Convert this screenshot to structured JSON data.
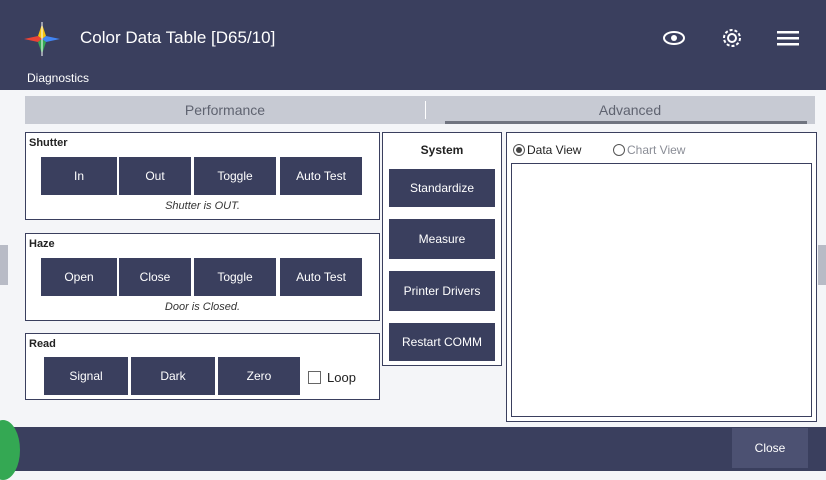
{
  "header": {
    "title": "Color Data Table [D65/10]",
    "icons": [
      "eye-icon",
      "gear-icon",
      "menu-icon"
    ]
  },
  "subheader": {
    "label": "Diagnostics"
  },
  "tabs": [
    {
      "label": "Performance",
      "active": false
    },
    {
      "label": "Advanced",
      "active": true
    }
  ],
  "shutter": {
    "label": "Shutter",
    "buttons": [
      "In",
      "Out",
      "Toggle",
      "Auto Test"
    ],
    "status": "Shutter is OUT."
  },
  "haze": {
    "label": "Haze",
    "buttons": [
      "Open",
      "Close",
      "Toggle",
      "Auto Test"
    ],
    "status": "Door is Closed."
  },
  "read": {
    "label": "Read",
    "buttons": [
      "Signal",
      "Dark",
      "Zero"
    ],
    "loop_label": "Loop",
    "loop_checked": false
  },
  "system": {
    "label": "System",
    "buttons": [
      "Standardize",
      "Measure",
      "Printer Drivers",
      "Restart COMM"
    ]
  },
  "view": {
    "options": [
      "Data View",
      "Chart View"
    ],
    "selected": "Data View"
  },
  "footer": {
    "close_label": "Close"
  },
  "colors": {
    "primary": "#3a3f5e",
    "tab_bar": "#c7cad3",
    "background": "#f4f5f8"
  }
}
